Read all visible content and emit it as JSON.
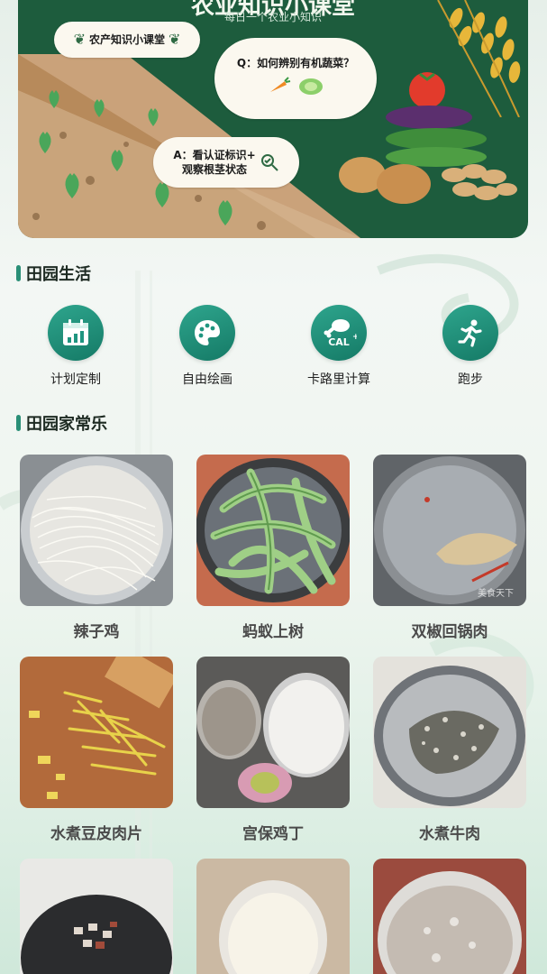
{
  "banner": {
    "title": "农业知识小课堂",
    "subtitle": "每日一个农业小知识",
    "badge": "农产知识小课堂",
    "question": "Q：如何辨别有机蔬菜？",
    "answer_line1": "A：看认证标识+",
    "answer_line2": "观察根茎状态"
  },
  "sections": {
    "life": "田园生活",
    "home": "田园家常乐"
  },
  "features": [
    {
      "label": "计划定制",
      "icon": "calendar-chart-icon"
    },
    {
      "label": "自由绘画",
      "icon": "palette-icon"
    },
    {
      "label": "卡路里计算",
      "icon": "chicken-leg-cal-icon"
    },
    {
      "label": "跑步",
      "icon": "running-person-icon"
    }
  ],
  "recipes": [
    {
      "name": "辣子鸡"
    },
    {
      "name": "蚂蚁上树"
    },
    {
      "name": "双椒回锅肉",
      "watermark": "美食天下"
    },
    {
      "name": "水煮豆皮肉片"
    },
    {
      "name": "宫保鸡丁"
    },
    {
      "name": "水煮牛肉"
    },
    {
      "name": ""
    },
    {
      "name": ""
    },
    {
      "name": ""
    }
  ],
  "colors": {
    "banner_green": "#1d5c3d",
    "accent_teal": "#2a8f77",
    "icon_teal": "#1f9580"
  }
}
